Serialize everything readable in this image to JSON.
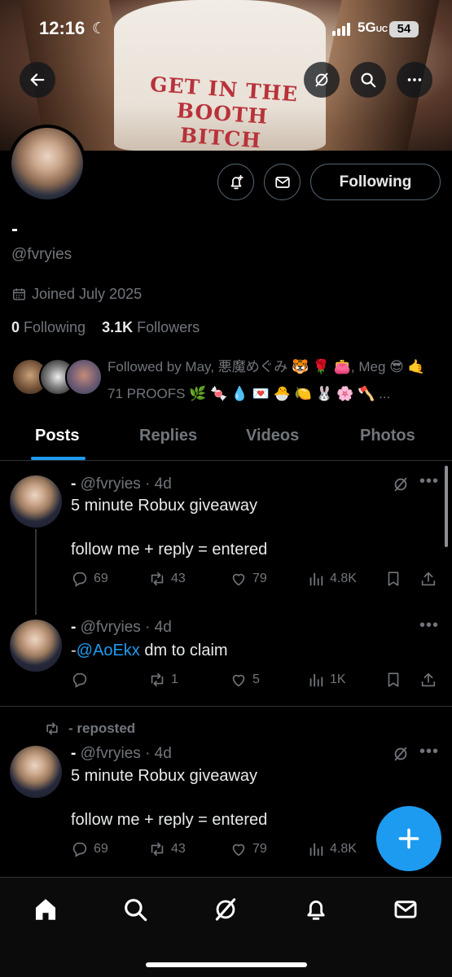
{
  "status_bar": {
    "time": "12:16",
    "network": "5G",
    "network_suffix": "UC",
    "battery": "54"
  },
  "banner": {
    "shirt_text": "GET IN THE\nBOOTH BITCH"
  },
  "profile": {
    "name": "-",
    "handle": "@fvryies",
    "joined": "Joined July 2025",
    "following_count": "0",
    "following_label": "Following",
    "followers_count": "3.1K",
    "followers_label": "Followers",
    "followed_by": "Followed by May, 悪魔めぐみ 🐯 🌹 👛, Meg 😎 🤙 71 PROOFS 🌿 🍬 💧 💌 🐣 🍋 🐰 🌸 🪓 ...",
    "following_button": "Following"
  },
  "tabs": [
    "Posts",
    "Replies",
    "Videos",
    "Photos"
  ],
  "posts": [
    {
      "name": "-",
      "handle": "@fvryies",
      "age": "· 4d",
      "text": "5 minute Robux giveaway\n\nfollow me + reply = entered",
      "replies": "69",
      "reposts": "43",
      "likes": "79",
      "views": "4.8K"
    },
    {
      "name": "-",
      "handle": "@fvryies",
      "age": "· 4d",
      "prefix": "-",
      "mention": "@AoEkx",
      "text": " dm to claim",
      "replies": "",
      "reposts": "1",
      "likes": "5",
      "views": "1K"
    },
    {
      "repost_label": "- reposted",
      "name": "-",
      "handle": "@fvryies",
      "age": "· 4d",
      "text": "5 minute Robux giveaway\n\nfollow me + reply = entered",
      "replies": "69",
      "reposts": "43",
      "likes": "79",
      "views": "4.8K"
    }
  ],
  "icons": {
    "back": "back-arrow-icon",
    "grok": "grok-icon",
    "search": "search-icon",
    "more": "more-icon",
    "notify": "bell-plus-icon",
    "message": "mail-icon",
    "reply": "reply-icon",
    "repost": "repost-icon",
    "like": "heart-icon",
    "views": "views-icon",
    "bookmark": "bookmark-icon",
    "share": "share-icon",
    "compose": "plus-icon",
    "home": "home-icon",
    "notifications": "bell-icon",
    "messages": "mail-icon"
  },
  "colors": {
    "accent": "#1d9bf0",
    "background": "#000000",
    "muted": "#71767b",
    "border": "#2f3336"
  }
}
